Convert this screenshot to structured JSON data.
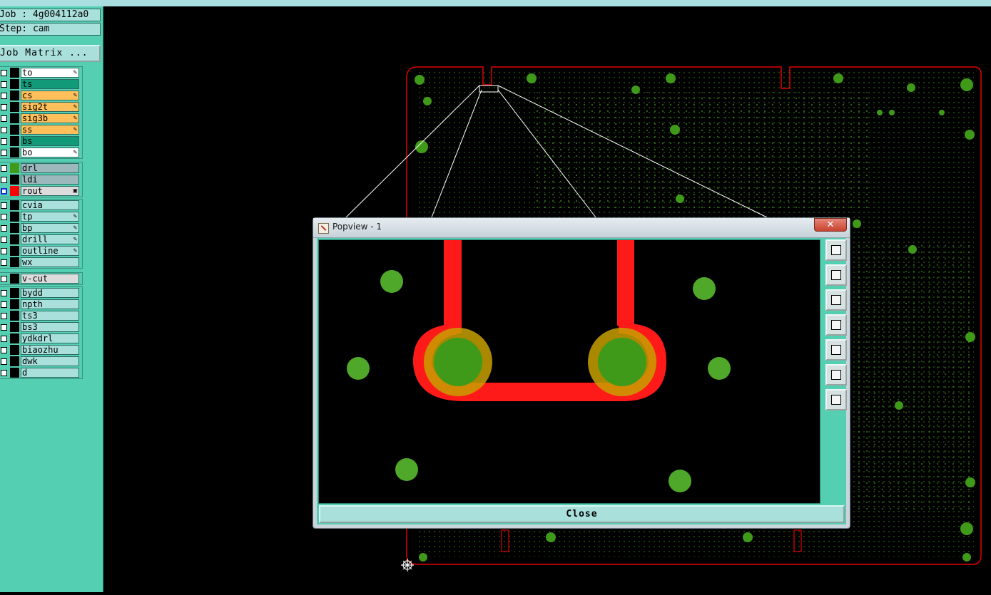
{
  "header": {
    "job_text": "Job : 4g004112a0",
    "step_text": "Step: cam",
    "job_matrix_label": "Job Matrix ..."
  },
  "layer_groups": [
    {
      "layers": [
        {
          "name": "to",
          "bg": "#ffffff",
          "mark": "✎"
        },
        {
          "name": "ts",
          "bg": "#129a78",
          "mark": ""
        },
        {
          "name": "cs",
          "bg": "#ffbf5a",
          "mark": "✎"
        },
        {
          "name": "sig2t",
          "bg": "#ffbf5a",
          "mark": "✎"
        },
        {
          "name": "sig3b",
          "bg": "#ffbf5a",
          "mark": "✎"
        },
        {
          "name": "ss",
          "bg": "#ffbf5a",
          "mark": "✎"
        },
        {
          "name": "bs",
          "bg": "#129a78",
          "mark": ""
        },
        {
          "name": "bo",
          "bg": "#ffffff",
          "mark": "✎"
        }
      ]
    },
    {
      "layers": [
        {
          "name": "drl",
          "bg": "#9cb8bc",
          "mark": "",
          "swatch": "#3f9a1a"
        },
        {
          "name": "ldi",
          "bg": "#9cb8bc",
          "mark": ""
        },
        {
          "name": "rout",
          "bg": "#dcdcdc",
          "mark": "▣",
          "swatch": "#ff0000",
          "blue": true
        }
      ]
    },
    {
      "layers": [
        {
          "name": "cvia",
          "bg": "#a9e0dc",
          "mark": ""
        },
        {
          "name": "tp",
          "bg": "#a9e0dc",
          "mark": "✎"
        },
        {
          "name": "bp",
          "bg": "#a9e0dc",
          "mark": "✎"
        },
        {
          "name": "drill",
          "bg": "#a9e0dc",
          "mark": "✎"
        },
        {
          "name": "outline",
          "bg": "#a9e0dc",
          "mark": "✎"
        },
        {
          "name": "wx",
          "bg": "#a9e0dc",
          "mark": ""
        }
      ]
    },
    {
      "layers": [
        {
          "name": "v-cut",
          "bg": "#dcdcdc",
          "mark": ""
        }
      ]
    },
    {
      "layers": [
        {
          "name": "bydd",
          "bg": "#a9e0dc",
          "mark": ""
        },
        {
          "name": "npth",
          "bg": "#a9e0dc",
          "mark": ""
        },
        {
          "name": "ts3",
          "bg": "#a9e0dc",
          "mark": ""
        },
        {
          "name": "bs3",
          "bg": "#a9e0dc",
          "mark": ""
        },
        {
          "name": "ydkdrl",
          "bg": "#a9e0dc",
          "mark": ""
        },
        {
          "name": "biaozhu",
          "bg": "#a9e0dc",
          "mark": ""
        },
        {
          "name": "dwk",
          "bg": "#a9e0dc",
          "mark": ""
        },
        {
          "name": "d",
          "bg": "#a9e0dc",
          "mark": ""
        }
      ]
    }
  ],
  "popup": {
    "title": "Popview - 1",
    "close_x": "✕",
    "close_button_label": "Close",
    "tool_buttons": [
      "zoom-fit-icon",
      "pan-up-icon",
      "pan-down-icon",
      "pan-left-icon",
      "pan-right-icon",
      "zoom-in-icon",
      "zoom-out-icon"
    ]
  },
  "colors": {
    "panel": "#55cfb1",
    "outline": "#ff0000",
    "pad": "#3f9a1a",
    "pad_small": "#4fa82a",
    "overlap": "#c8a000"
  }
}
